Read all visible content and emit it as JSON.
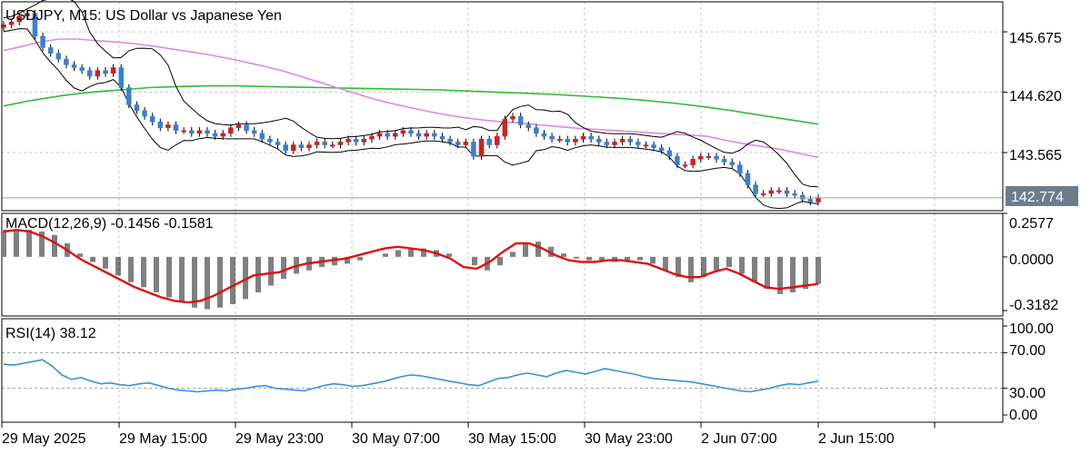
{
  "colors": {
    "background": "#ffffff",
    "grid": "#c8c8c8",
    "frame": "#000000",
    "bull_candle": "#d11f1f",
    "bear_candle": "#3a7fd1",
    "bollinger": "#000000",
    "ma_fast": "#dd88dd",
    "ma_slow": "#33bb33",
    "price_line": "#8fa4b8",
    "price_tag_bg": "#6b7c8c",
    "price_tag_text": "#ffffff",
    "macd_hist": "#000000",
    "macd_signal": "#dd1111",
    "rsi_line": "#3a8fd8",
    "rsi_levels": "#9a9a9a"
  },
  "price_panel": {
    "title": "USDJPY, M15:  US Dollar vs Japanese Yen",
    "y_ticks": [
      "145.675",
      "144.620",
      "143.565"
    ],
    "current_price": "142.774"
  },
  "macd_panel": {
    "label": "MACD(12,26,9) -0.1456 -0.1581",
    "y_ticks": [
      "0.2577",
      "0.0000",
      "-0.3182"
    ]
  },
  "rsi_panel": {
    "label": "RSI(14) 38.12",
    "y_ticks": [
      "100.00",
      "70.00",
      "30.00",
      "0.00"
    ]
  },
  "x_axis": {
    "labels": [
      "29 May 2025",
      "29 May 15:00",
      "29 May 23:00",
      "30 May 07:00",
      "30 May 15:00",
      "30 May 23:00",
      "2 Jun 07:00",
      "2 Jun 15:00"
    ]
  },
  "chart_data": [
    {
      "type": "line",
      "subtype": "candlestick",
      "title": "USDJPY, M15:  US Dollar vs Japanese Yen",
      "x_labels": [
        "29 May 2025",
        "29 May 15:00",
        "29 May 23:00",
        "30 May 07:00",
        "30 May 15:00",
        "30 May 23:00",
        "2 Jun 07:00",
        "2 Jun 15:00"
      ],
      "y_range": [
        142.55,
        146.2
      ],
      "y_ticks": [
        145.675,
        144.62,
        143.565
      ],
      "current_price": 142.774,
      "close_series": [
        145.8,
        145.85,
        145.95,
        146.0,
        145.6,
        145.4,
        145.3,
        145.2,
        145.1,
        145.05,
        145.0,
        144.9,
        145.0,
        144.95,
        145.05,
        144.7,
        144.4,
        144.3,
        144.2,
        144.1,
        144.0,
        144.05,
        143.95,
        143.95,
        143.9,
        143.95,
        143.9,
        143.85,
        143.9,
        144.0,
        144.05,
        143.95,
        143.9,
        143.8,
        143.75,
        143.7,
        143.6,
        143.7,
        143.65,
        143.7,
        143.75,
        143.7,
        143.7,
        143.75,
        143.8,
        143.75,
        143.8,
        143.85,
        143.9,
        143.85,
        143.9,
        143.95,
        143.9,
        143.85,
        143.9,
        143.85,
        143.8,
        143.75,
        143.7,
        143.75,
        143.5,
        143.8,
        143.7,
        143.85,
        144.15,
        144.2,
        144.05,
        144.0,
        143.9,
        143.85,
        143.8,
        143.8,
        143.75,
        143.8,
        143.85,
        143.8,
        143.75,
        143.7,
        143.75,
        143.8,
        143.75,
        143.7,
        143.7,
        143.65,
        143.6,
        143.5,
        143.35,
        143.35,
        143.45,
        143.5,
        143.5,
        143.45,
        143.4,
        143.35,
        143.2,
        143.0,
        142.85,
        142.85,
        142.9,
        142.9,
        142.85,
        142.82,
        142.75,
        142.7,
        142.774
      ],
      "ma_fast_series": [
        145.35,
        145.42,
        145.5,
        145.55,
        145.55,
        145.52,
        145.5,
        145.47,
        145.43,
        145.38,
        145.33,
        145.28,
        145.22,
        145.15,
        145.08,
        145.0,
        144.9,
        144.8,
        144.7,
        144.6,
        144.5,
        144.42,
        144.35,
        144.28,
        144.22,
        144.17,
        144.13,
        144.1,
        144.08,
        144.05,
        144.02,
        143.99,
        143.97,
        143.95,
        143.93,
        143.91,
        143.89,
        143.87,
        143.85,
        143.78,
        143.72,
        143.67,
        143.62,
        143.55,
        143.48
      ],
      "ma_slow_series": [
        144.38,
        144.48,
        144.56,
        144.62,
        144.66,
        144.7,
        144.72,
        144.73,
        144.73,
        144.72,
        144.71,
        144.7,
        144.69,
        144.68,
        144.67,
        144.66,
        144.64,
        144.62,
        144.6,
        144.58,
        144.55,
        144.52,
        144.48,
        144.43,
        144.37,
        144.3,
        144.22,
        144.14,
        144.06
      ],
      "series": [
        {
          "name": "",
          "values": []
        }
      ]
    },
    {
      "type": "bar",
      "title": "MACD(12,26,9) -0.1456 -0.1581",
      "y_range": [
        -0.35,
        0.2577
      ],
      "y_ticks": [
        0.2577,
        0.0,
        -0.3182
      ],
      "macd_value": -0.1456,
      "signal_value": -0.1581,
      "histogram": [
        0.16,
        0.16,
        0.16,
        0.15,
        0.13,
        0.08,
        0.02,
        -0.03,
        -0.07,
        -0.11,
        -0.15,
        -0.18,
        -0.21,
        -0.24,
        -0.27,
        -0.3,
        -0.31,
        -0.3,
        -0.28,
        -0.25,
        -0.21,
        -0.17,
        -0.13,
        -0.1,
        -0.08,
        -0.06,
        -0.05,
        -0.04,
        -0.02,
        0.0,
        0.02,
        0.04,
        0.05,
        0.05,
        0.04,
        0.02,
        0.0,
        -0.05,
        -0.08,
        -0.05,
        0.03,
        0.08,
        0.09,
        0.06,
        0.02,
        -0.01,
        -0.02,
        -0.03,
        -0.03,
        -0.03,
        -0.02,
        -0.04,
        -0.08,
        -0.12,
        -0.15,
        -0.12,
        -0.08,
        -0.06,
        -0.1,
        -0.15,
        -0.19,
        -0.22,
        -0.21,
        -0.19,
        -0.16
      ],
      "signal_line": [
        0.15,
        0.16,
        0.15,
        0.12,
        0.08,
        0.03,
        -0.02,
        -0.06,
        -0.1,
        -0.14,
        -0.18,
        -0.21,
        -0.24,
        -0.26,
        -0.27,
        -0.26,
        -0.23,
        -0.19,
        -0.15,
        -0.11,
        -0.1,
        -0.09,
        -0.06,
        -0.04,
        -0.03,
        -0.02,
        -0.01,
        0.01,
        0.03,
        0.05,
        0.06,
        0.05,
        0.04,
        0.02,
        -0.01,
        -0.06,
        -0.07,
        -0.03,
        0.03,
        0.08,
        0.08,
        0.05,
        0.01,
        -0.02,
        -0.03,
        -0.03,
        -0.02,
        -0.02,
        -0.03,
        -0.04,
        -0.07,
        -0.1,
        -0.12,
        -0.12,
        -0.09,
        -0.07,
        -0.1,
        -0.14,
        -0.18,
        -0.19,
        -0.18,
        -0.17,
        -0.16
      ]
    },
    {
      "type": "line",
      "title": "RSI(14) 38.12",
      "y_range": [
        0,
        100
      ],
      "y_ticks": [
        100,
        70,
        30,
        0
      ],
      "levels": [
        70,
        30
      ],
      "current_value": 38.12,
      "series": [
        {
          "name": "",
          "values": [
            57,
            56,
            58,
            60,
            62,
            55,
            45,
            40,
            42,
            38,
            35,
            36,
            34,
            33,
            35,
            36,
            33,
            30,
            28,
            27,
            26,
            27,
            28,
            27,
            29,
            30,
            32,
            33,
            30,
            29,
            28,
            27,
            30,
            33,
            35,
            34,
            32,
            33,
            35,
            37,
            40,
            43,
            45,
            44,
            42,
            40,
            38,
            36,
            34,
            33,
            37,
            41,
            42,
            45,
            47,
            45,
            43,
            47,
            50,
            48,
            46,
            49,
            52,
            50,
            48,
            46,
            43,
            41,
            40,
            39,
            38,
            37,
            35,
            33,
            31,
            29,
            27,
            26,
            28,
            30,
            33,
            35,
            34,
            36,
            38
          ]
        }
      ]
    }
  ]
}
